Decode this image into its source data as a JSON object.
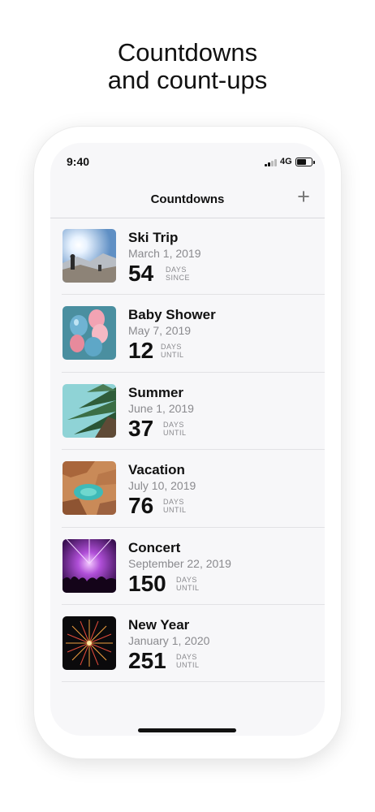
{
  "headline": {
    "line1": "Countdowns",
    "line2": "and count-ups"
  },
  "status_bar": {
    "time": "9:40",
    "network": "4G"
  },
  "nav": {
    "title": "Countdowns",
    "add_icon": "plus-icon"
  },
  "events": [
    {
      "title": "Ski Trip",
      "date": "March 1, 2019",
      "count": "54",
      "unit_line1": "DAYS",
      "unit_line2": "SINCE",
      "thumb_icon": "ski-trip-photo"
    },
    {
      "title": "Baby Shower",
      "date": "May 7, 2019",
      "count": "12",
      "unit_line1": "DAYS",
      "unit_line2": "UNTIL",
      "thumb_icon": "balloons-photo"
    },
    {
      "title": "Summer",
      "date": "June 1, 2019",
      "count": "37",
      "unit_line1": "DAYS",
      "unit_line2": "UNTIL",
      "thumb_icon": "palm-pool-photo"
    },
    {
      "title": "Vacation",
      "date": "July 10, 2019",
      "count": "76",
      "unit_line1": "DAYS",
      "unit_line2": "UNTIL",
      "thumb_icon": "beach-cove-photo"
    },
    {
      "title": "Concert",
      "date": "September 22, 2019",
      "count": "150",
      "unit_line1": "DAYS",
      "unit_line2": "UNTIL",
      "thumb_icon": "concert-crowd-photo"
    },
    {
      "title": "New Year",
      "date": "January 1, 2020",
      "count": "251",
      "unit_line1": "DAYS",
      "unit_line2": "UNTIL",
      "thumb_icon": "fireworks-photo"
    }
  ],
  "colors": {
    "accent_gray": "#8a8a8e",
    "text": "#111111",
    "screen_bg": "#f7f7f9"
  }
}
